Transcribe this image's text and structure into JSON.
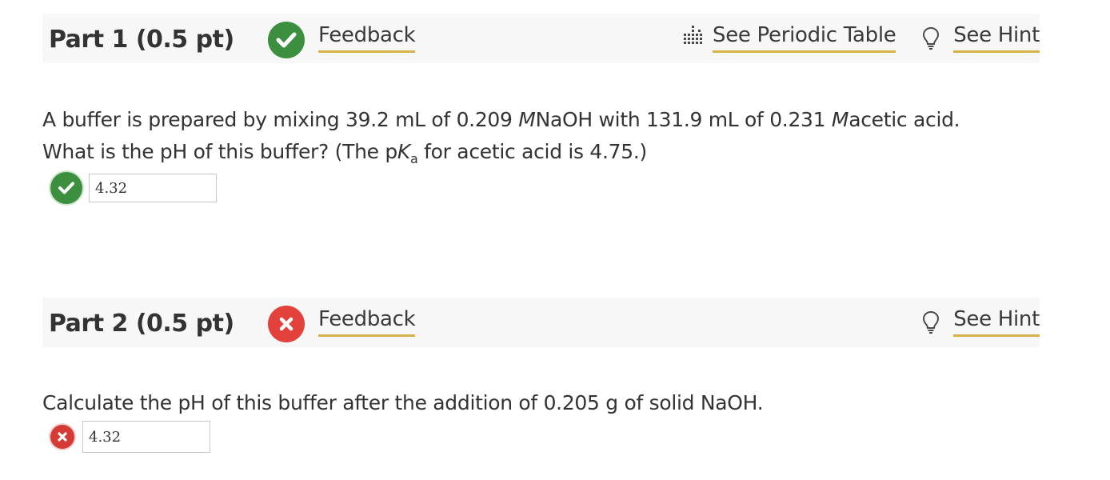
{
  "part1": {
    "title": "Part 1 (0.5 pt)",
    "status": "correct",
    "feedback_label": "Feedback",
    "periodic_label": "See Periodic Table",
    "hint_label": "See Hint",
    "question_line1": {
      "a": "A buffer is prepared by mixing 39.2 mL of 0.209 ",
      "unit1": "M",
      "b": "NaOH with 131.9 mL of 0.231 ",
      "unit2": "M",
      "c": "acetic acid."
    },
    "question_line2": {
      "a": "What is the pH of this buffer? (The p",
      "k": "K",
      "sub": "a",
      "b": " for acetic acid is 4.75.)"
    },
    "answer_value": "4.32"
  },
  "part2": {
    "title": "Part 2 (0.5 pt)",
    "status": "incorrect",
    "feedback_label": "Feedback",
    "hint_label": "See Hint",
    "question": "Calculate the pH of this buffer after the addition of 0.205 g of solid NaOH.",
    "answer_value": "4.32"
  },
  "colors": {
    "correct": "#3c8f3e",
    "incorrect": "#e3413b",
    "link_underline": "#d7b14a",
    "header_bg": "#f7f7f7"
  },
  "icons": {
    "correct": "check-circle-icon",
    "incorrect": "x-circle-icon",
    "periodic": "periodic-table-icon",
    "hint": "lightbulb-icon"
  }
}
